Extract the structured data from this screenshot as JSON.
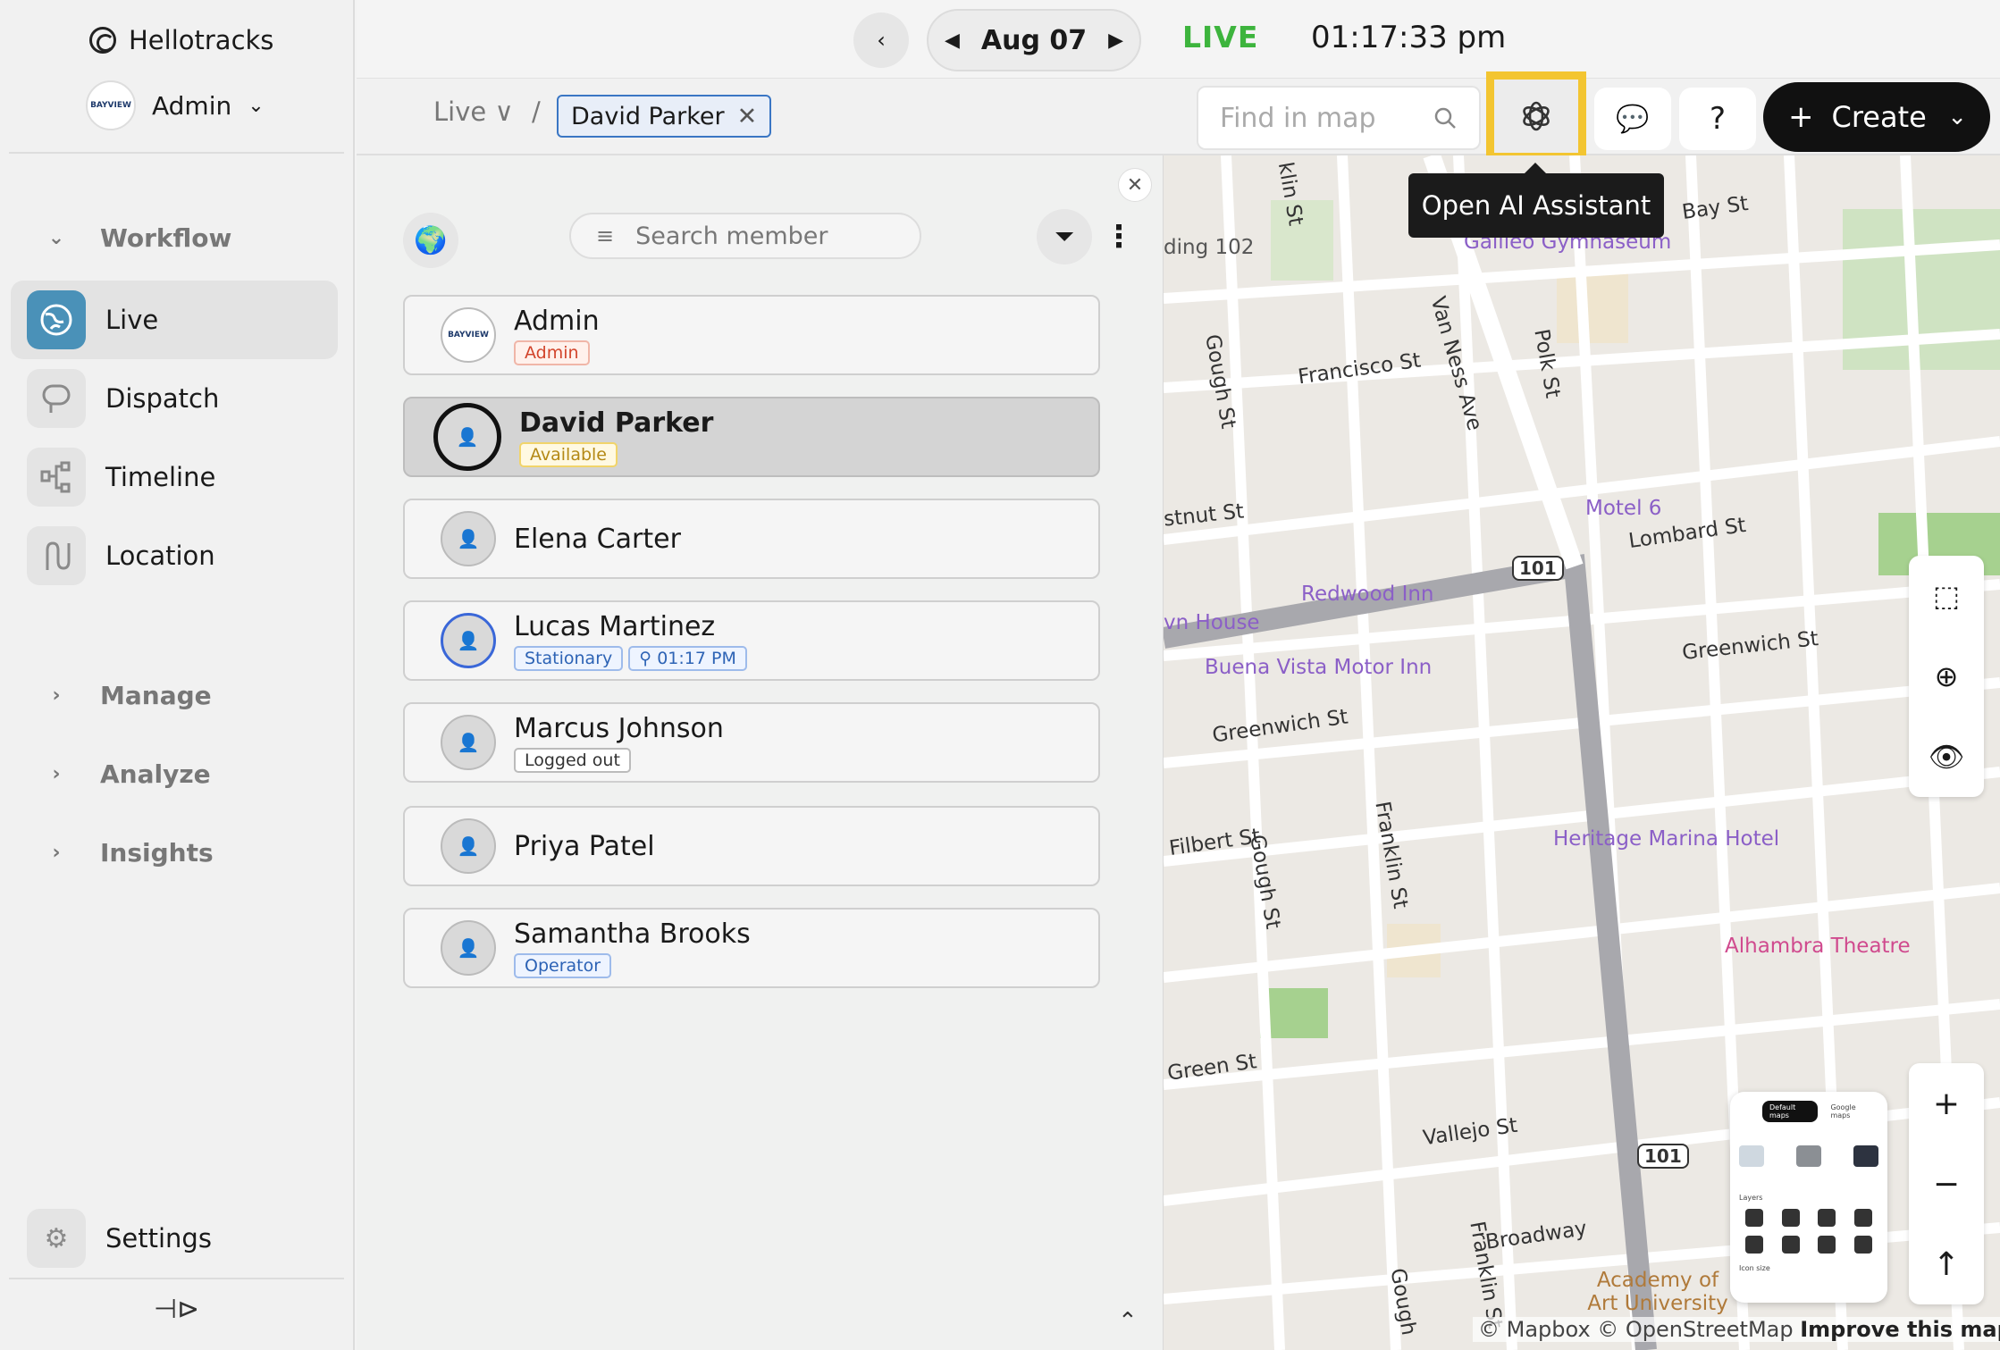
{
  "sidebar": {
    "brand": "Hellotracks",
    "account": {
      "name": "Admin",
      "logo_text": "BAYVIEW"
    },
    "sections": {
      "workflow": "Workflow",
      "manage": "Manage",
      "analyze": "Analyze",
      "insights": "Insights"
    },
    "items": {
      "live": "Live",
      "dispatch": "Dispatch",
      "timeline": "Timeline",
      "location": "Location",
      "settings": "Settings"
    }
  },
  "topbar": {
    "date": "Aug 07",
    "live": "LIVE",
    "time": "01:17:33 pm"
  },
  "subbar": {
    "breadcrumb_live": "Live",
    "breadcrumb_sep": "/",
    "chip": "David Parker",
    "find_placeholder": "Find in map",
    "create": "Create",
    "tooltip": "Open AI Assistant"
  },
  "panel": {
    "search_placeholder": "Search member",
    "members": [
      {
        "name": "Admin",
        "tags": [
          "Admin"
        ]
      },
      {
        "name": "David Parker",
        "tags": [
          "Available"
        ]
      },
      {
        "name": "Elena Carter",
        "tags": []
      },
      {
        "name": "Lucas Martinez",
        "tags": [
          "Stationary",
          "01:17 PM"
        ]
      },
      {
        "name": "Marcus Johnson",
        "tags": [
          "Logged out"
        ]
      },
      {
        "name": "Priya Patel",
        "tags": []
      },
      {
        "name": "Samantha Brooks",
        "tags": [
          "Operator"
        ]
      }
    ]
  },
  "map": {
    "streets": [
      "Francisco St",
      "Van Ness Ave",
      "Polk St",
      "Gough St",
      "Lombard St",
      "Greenwich St",
      "Greenwich St",
      "Filbert St",
      "Franklin St",
      "Gough St",
      "Green St",
      "Vallejo St",
      "Broadway",
      "Bay St",
      "klin St",
      "stnut St",
      "Gough",
      "Franklin St"
    ],
    "pois": [
      "Galileo Gymnaseum",
      "Motel 6",
      "Redwood Inn",
      "vn House",
      "Buena Vista Motor Inn",
      "Heritage Marina Hotel",
      "Alhambra Theatre",
      "Academy of Art University",
      "ding 102"
    ],
    "shields": [
      "101",
      "101"
    ],
    "style_card": {
      "tab_default": "Default maps",
      "tab_google": "Google maps",
      "layers": "Layers",
      "icon_size": "Icon size"
    },
    "attribution": "© Mapbox © OpenStreetMap",
    "improve": "Improve this map"
  }
}
